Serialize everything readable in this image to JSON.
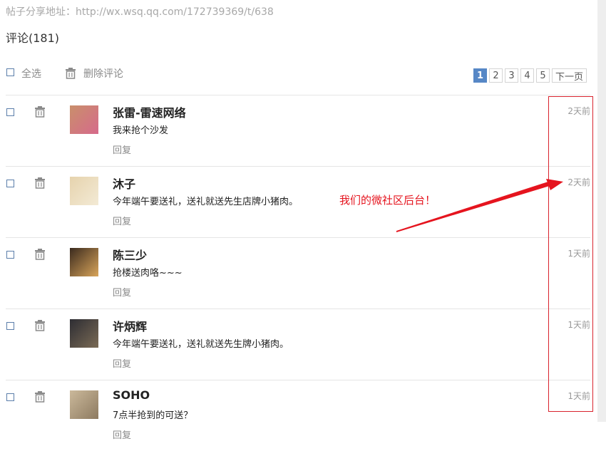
{
  "share": {
    "label": "帖子分享地址：",
    "url": "http://wx.wsq.qq.com/172739369/t/638"
  },
  "comments_title": "评论(181)",
  "toolbar": {
    "select_all": "全选",
    "delete_comments": "删除评论"
  },
  "pager": {
    "pages": [
      "1",
      "2",
      "3",
      "4",
      "5"
    ],
    "current": "1",
    "next": "下一页"
  },
  "comments": [
    {
      "name": "张雷-雷速网络",
      "text": "我来抢个沙发",
      "reply": "回复",
      "time": "2天前",
      "avatar_colors": [
        "#c98f6b",
        "#d66a8b"
      ]
    },
    {
      "name": "沐子",
      "text": "今年端午要送礼，送礼就送先生店牌小猪肉。",
      "reply": "回复",
      "time": "2天前",
      "avatar_colors": [
        "#e6d3ad",
        "#f3ead5"
      ]
    },
    {
      "name": "陈三少",
      "text": "抢楼送肉咯~~~",
      "reply": "回复",
      "time": "1天前",
      "avatar_colors": [
        "#3a2a1e",
        "#d9a55a"
      ]
    },
    {
      "name": "许炳辉",
      "text": "今年端午要送礼，送礼就送先生牌小猪肉。",
      "reply": "回复",
      "time": "1天前",
      "avatar_colors": [
        "#2d2d33",
        "#7a6a55"
      ]
    },
    {
      "name": "SOHO",
      "text": "7点半抢到的可送？",
      "reply": "回复",
      "time": "1天前",
      "avatar_colors": [
        "#cbb99b",
        "#8d7a60"
      ]
    }
  ],
  "annotation": {
    "text": "我们的微社区后台！",
    "color": "#e5141e"
  }
}
